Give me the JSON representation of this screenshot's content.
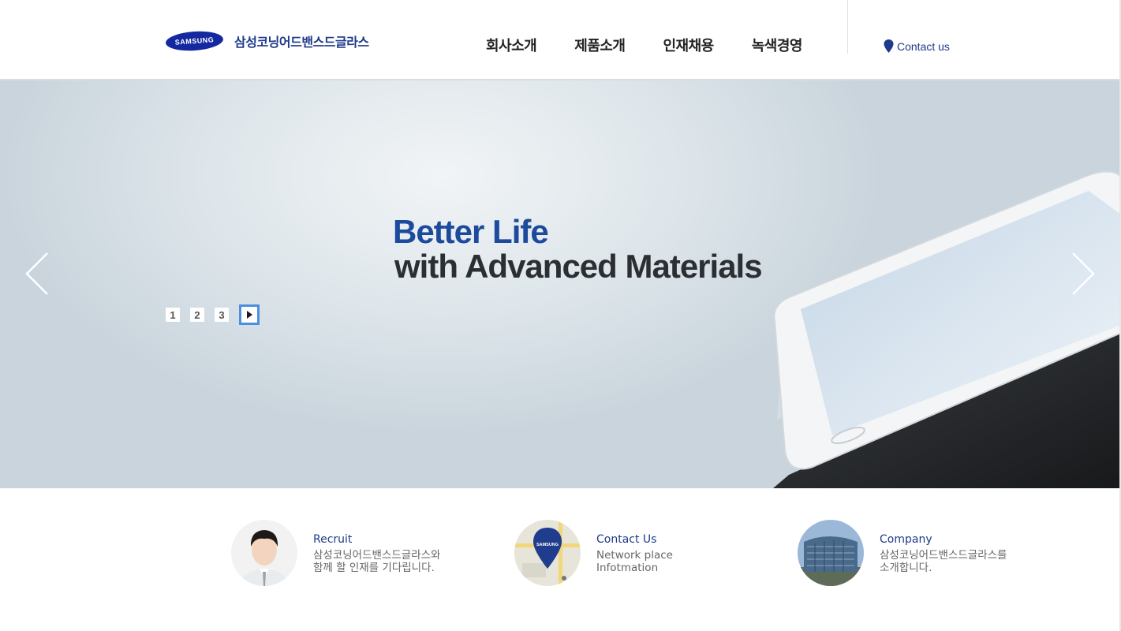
{
  "header": {
    "logo_brand": "SAMSUNG",
    "logo_text": "삼성코닝어드밴스드글라스",
    "nav": [
      "회사소개",
      "제품소개",
      "인재채용",
      "녹색경영"
    ],
    "contact_label": "Contact us"
  },
  "hero": {
    "headline_line1": "Better Life",
    "headline_line2": "with Advanced Materials",
    "pages": [
      "1",
      "2",
      "3"
    ]
  },
  "features": [
    {
      "title": "Recruit",
      "desc_line1": "삼성코닝어드밴스드글라스와",
      "desc_line2": "함께 할 인재를 기다립니다."
    },
    {
      "title": "Contact Us",
      "desc_line1": "Network place",
      "desc_line2": "Infotmation"
    },
    {
      "title": "Company",
      "desc_line1": "삼성코닝어드밴스드글라스를",
      "desc_line2": "소개합니다."
    }
  ],
  "map_pin_brand": "SAMSUNG",
  "colors": {
    "brand_blue": "#1428a0",
    "accent_blue": "#1e3a8a",
    "headline_blue": "#1c4a9c",
    "pager_active": "#4a8fe0"
  }
}
